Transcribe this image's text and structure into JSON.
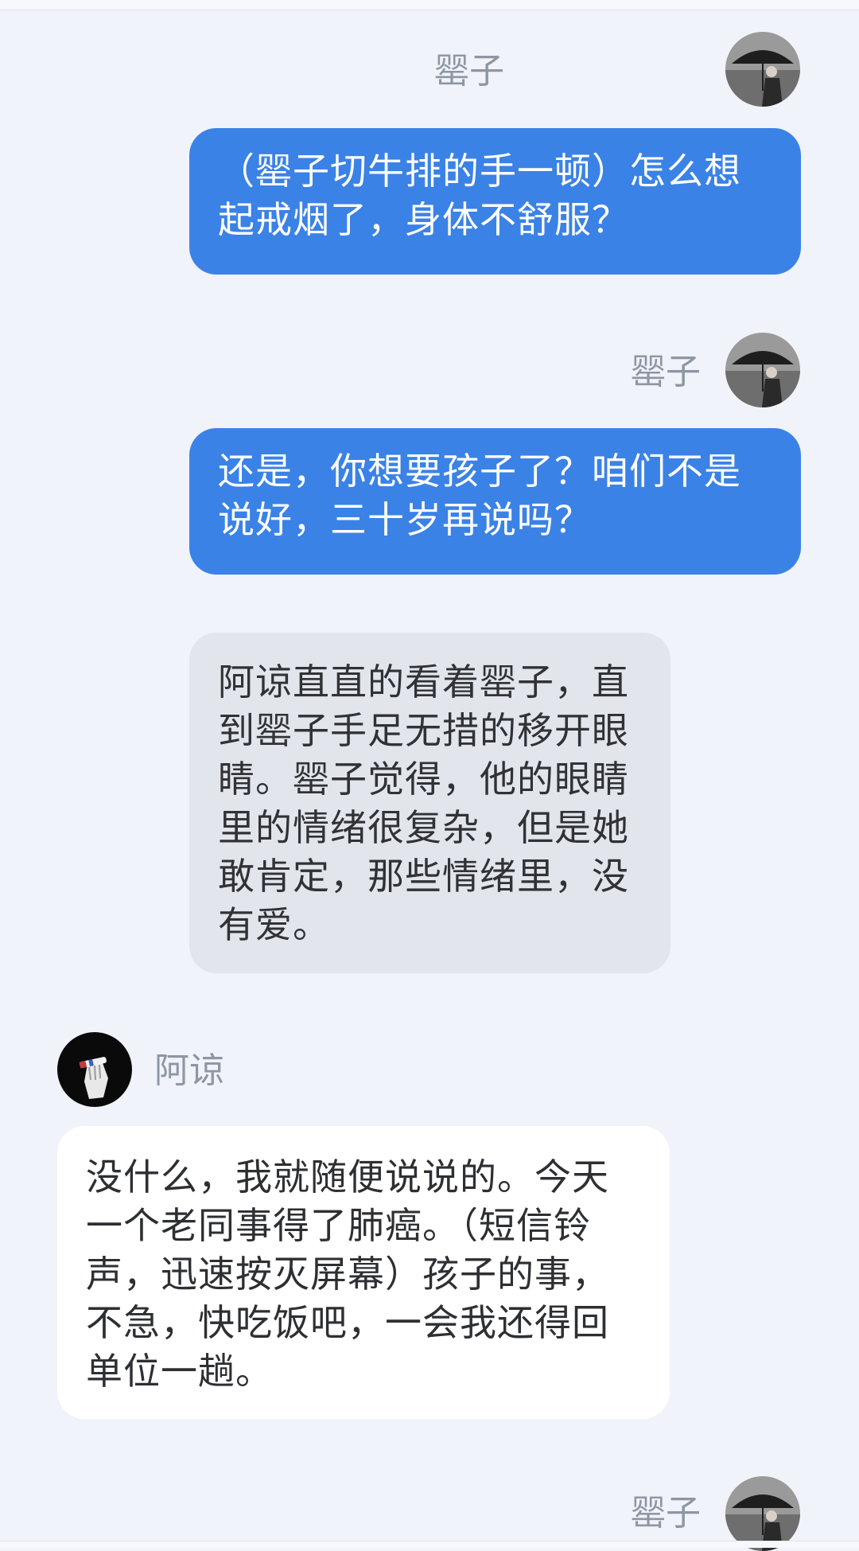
{
  "user_me": {
    "name": "罂子",
    "avatar_icon": "woman-with-umbrella-avatar"
  },
  "user_other": {
    "name": "阿谅",
    "avatar_icon": "hand-holding-cigarette-avatar"
  },
  "messages": [
    {
      "speaker": "罂子",
      "text": "（罂子切牛排的手一顿）怎么想起戒烟了，身体不舒服？"
    },
    {
      "speaker": "罂子",
      "text": "还是，你想要孩子了？咱们不是说好，三十岁再说吗？"
    },
    {
      "speaker": "narration",
      "text": "阿谅直直的看着罂子，直到罂子手足无措的移开眼睛。罂子觉得，他的眼睛里的情绪很复杂，但是她敢肯定，那些情绪里，没有爱。"
    },
    {
      "speaker": "阿谅",
      "text": "没什么，我就随便说说的。今天一个老同事得了肺癌。（短信铃声，迅速按灭屏幕）孩子的事，不急，快吃饭吧，一会我还得回单位一趟。"
    },
    {
      "speaker": "罂子",
      "text": ""
    }
  ],
  "colors": {
    "me_bubble": "#3b82e6",
    "narration_bubble": "#e2e5eb",
    "other_bubble": "#ffffff",
    "background": "#f0f3f9"
  }
}
